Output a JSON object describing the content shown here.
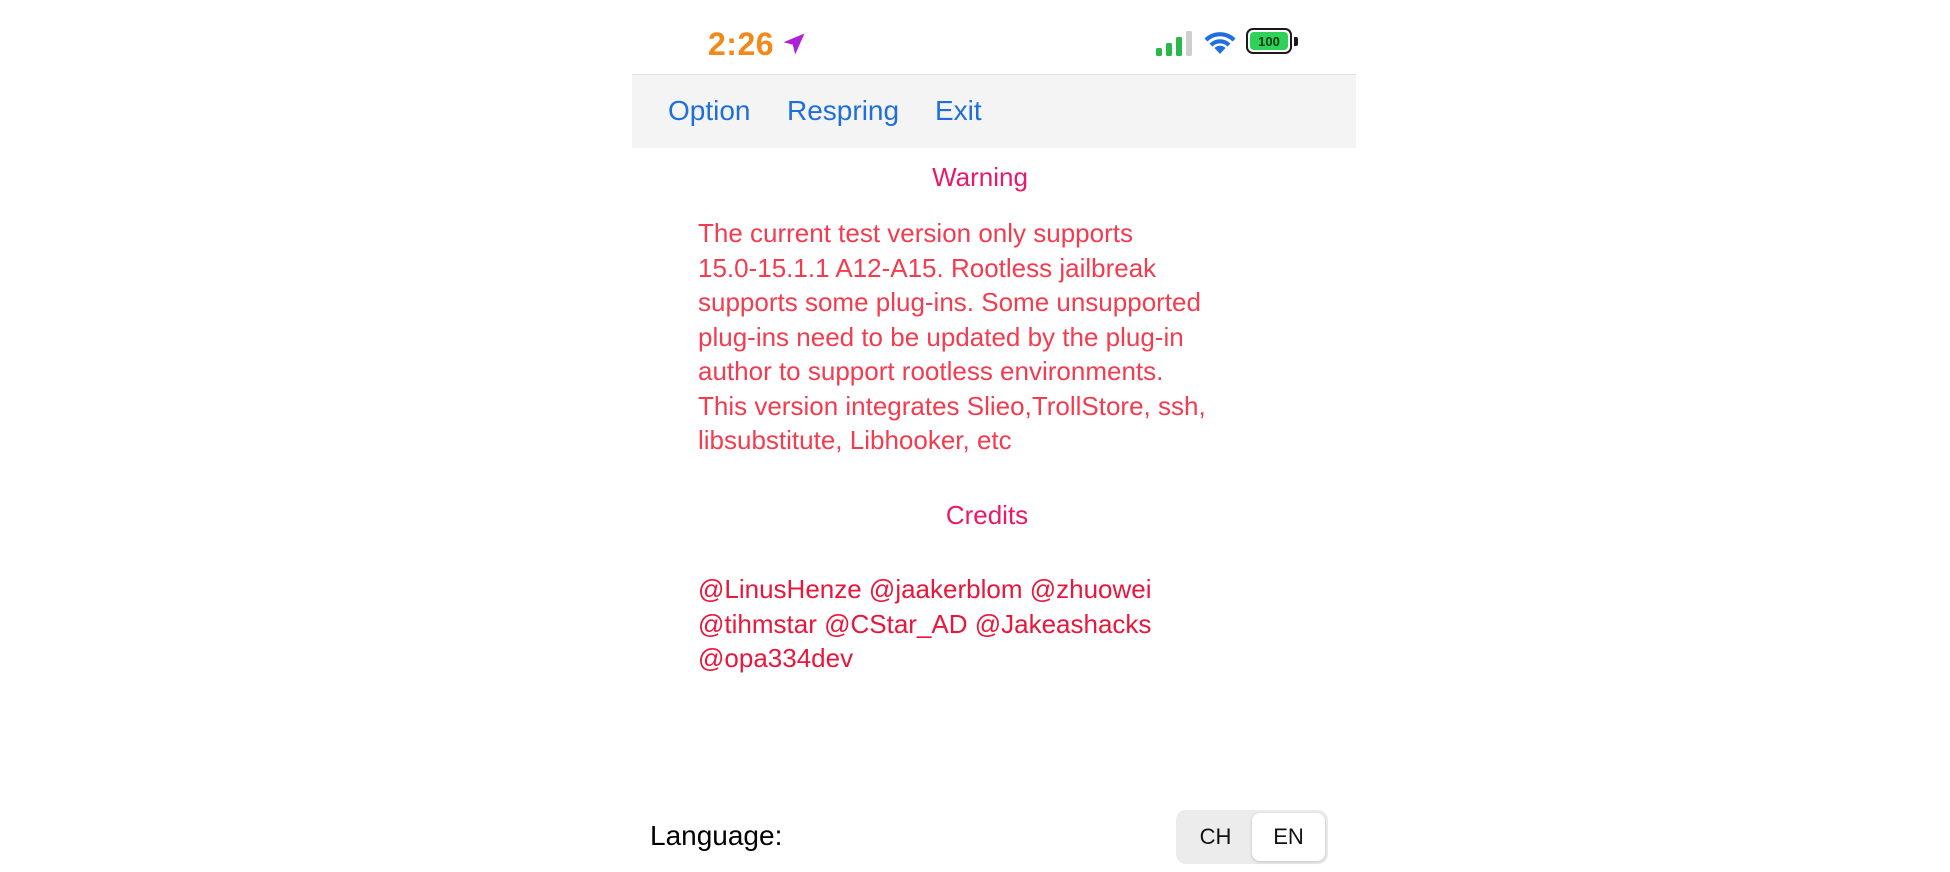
{
  "status_bar": {
    "time": "2:26",
    "battery_level": "100",
    "time_color": "#f28a1b",
    "location_icon": "location-arrow-icon",
    "location_color": "#b11ed8",
    "signal_color": "#2bb84a",
    "wifi_color": "#1f6fe0"
  },
  "toolbar": {
    "buttons": [
      {
        "label": "Option"
      },
      {
        "label": "Respring"
      },
      {
        "label": "Exit"
      }
    ],
    "button_color": "#1e6fd9"
  },
  "warning": {
    "title": "Warning",
    "text": "The current test version only supports\n15.0-15.1.1 A12-A15. Rootless jailbreak\nsupports some plug-ins. Some unsupported\nplug-ins need to be updated by the plug-in\nauthor to support rootless environments.\nThis version integrates Slieo,TrollStore, ssh,\nlibsubstitute, Libhooker, etc",
    "title_color": "#e8196a",
    "text_color": "#f23c4f"
  },
  "credits": {
    "title": "Credits",
    "text": " @LinusHenze @jaakerblom @zhuowei\n@tihmstar @CStar_AD @Jakeashacks\n@opa334dev",
    "title_color": "#e8196a",
    "text_color": "#e8173c"
  },
  "language": {
    "label": "Language:",
    "options": [
      "CH",
      "EN"
    ],
    "selected": "EN"
  }
}
